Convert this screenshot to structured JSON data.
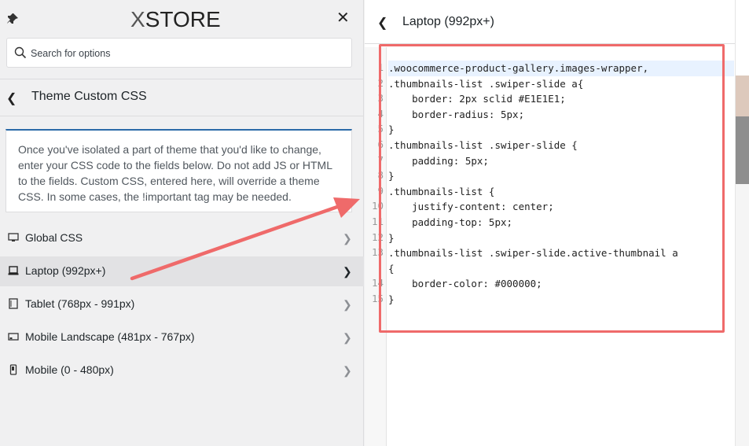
{
  "logo": {
    "prefix": "X",
    "text": "STORE"
  },
  "search": {
    "placeholder": "Search for options"
  },
  "section": {
    "title": "Theme Custom CSS"
  },
  "description": "Once you've isolated a part of theme that you'd like to change, enter your CSS code to the fields below. Do not add JS or HTML to the fields. Custom CSS, entered here, will override a theme CSS. In some cases, the !important tag may be needed.",
  "menu": [
    {
      "label": "Global CSS",
      "icon": "desktop-icon"
    },
    {
      "label": "Laptop (992px+)",
      "icon": "laptop-icon",
      "active": true
    },
    {
      "label": "Tablet (768px - 991px)",
      "icon": "tablet-icon"
    },
    {
      "label": "Mobile Landscape (481px - 767px)",
      "icon": "mobile-landscape-icon"
    },
    {
      "label": "Mobile (0 - 480px)",
      "icon": "mobile-icon"
    }
  ],
  "panel": {
    "title": "Laptop (992px+)"
  },
  "editor": {
    "line_numbers": [
      "1",
      "2",
      "3",
      "4",
      "5",
      "6",
      "7",
      "8",
      "9",
      "10",
      "11",
      "12",
      "13",
      "14",
      "15"
    ],
    "lines": [
      ".woocommerce-product-gallery.images-wrapper,",
      ".thumbnails-list .swiper-slide a{",
      "    border: 2px sclid #E1E1E1;",
      "    border-radius: 5px;",
      "}",
      ".thumbnails-list .swiper-slide {",
      "    padding: 5px;",
      "}",
      ".thumbnails-list {",
      "    justify-content: center;",
      "    padding-top: 5px;",
      "}",
      ".thumbnails-list .swiper-slide.active-thumbnail a",
      "{",
      "    border-color: #000000;",
      "}"
    ]
  },
  "colors": {
    "accent": "#2c6aa8",
    "annotation": "#ef6a6a"
  }
}
